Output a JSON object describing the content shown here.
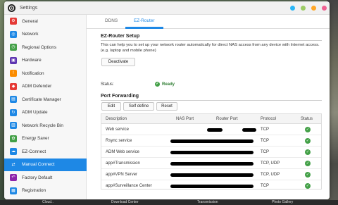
{
  "window": {
    "title": "Settings"
  },
  "sidebar": {
    "items": [
      {
        "label": "General",
        "icon": "gear-icon",
        "color": "#e53935",
        "glyph": "⚙"
      },
      {
        "label": "Network",
        "icon": "globe-icon",
        "color": "#1e88e5",
        "glyph": "◎"
      },
      {
        "label": "Regional Options",
        "icon": "clock-icon",
        "color": "#43a047",
        "glyph": "◷"
      },
      {
        "label": "Hardware",
        "icon": "chip-icon",
        "color": "#5e35b1",
        "glyph": "▣"
      },
      {
        "label": "Notification",
        "icon": "bell-icon",
        "color": "#fb8c00",
        "glyph": "!"
      },
      {
        "label": "ADM Defender",
        "icon": "shield-icon",
        "color": "#e53935",
        "glyph": "◆"
      },
      {
        "label": "Certificate Manager",
        "icon": "certificate-icon",
        "color": "#1e88e5",
        "glyph": "▤"
      },
      {
        "label": "ADM Update",
        "icon": "update-icon",
        "color": "#1e88e5",
        "glyph": "↻"
      },
      {
        "label": "Network Recycle Bin",
        "icon": "recycle-bin-icon",
        "color": "#1e88e5",
        "glyph": "▥"
      },
      {
        "label": "Energy Saver",
        "icon": "leaf-icon",
        "color": "#43a047",
        "glyph": "✿"
      },
      {
        "label": "EZ-Connect",
        "icon": "cloud-icon",
        "color": "#1e88e5",
        "glyph": "☁"
      },
      {
        "label": "Manual Connect",
        "icon": "connect-icon",
        "color": "#ffffff",
        "glyph": "⇄",
        "active": true
      },
      {
        "label": "Factory Default",
        "icon": "undo-icon",
        "color": "#8e24aa",
        "glyph": "↶"
      },
      {
        "label": "Registration",
        "icon": "registration-icon",
        "color": "#1e88e5",
        "glyph": "▦"
      }
    ]
  },
  "tabs": [
    {
      "label": "DDNS"
    },
    {
      "label": "EZ-Router",
      "active": true
    }
  ],
  "ez_router": {
    "title": "EZ-Router Setup",
    "description": "This can help you to set up your network router automatically for direct NAS access from any device with Internet access. (e.g. laptop and mobile phone)",
    "deactivate_label": "Deactivate",
    "status_label": "Status:",
    "status_value": "Ready"
  },
  "port_forwarding": {
    "title": "Port Forwarding",
    "buttons": {
      "edit": "Edit",
      "self_define": "Self define",
      "reset": "Reset"
    },
    "columns": [
      "Description",
      "NAS Port",
      "Router Port",
      "Protocol",
      "Status"
    ],
    "rows": [
      {
        "description": "Web service",
        "protocol": "TCP"
      },
      {
        "description": "Rsync service",
        "protocol": "TCP"
      },
      {
        "description": "ADM Web service",
        "protocol": "TCP"
      },
      {
        "description": "app#Transmission",
        "protocol": "TCP, UDP"
      },
      {
        "description": "app#VPN Server",
        "protocol": "TCP, UDP"
      },
      {
        "description": "app#Surveillance Center",
        "protocol": "TCP"
      }
    ]
  },
  "colors": {
    "accent": "#1e88e5",
    "ok": "#43a047",
    "dot1": "#29b6f6",
    "dot2": "#9ccc65",
    "dot3": "#ffa726",
    "dot4": "#f06292"
  },
  "taskbar": {
    "items": [
      "Cloud..",
      "Download Center",
      "Transmission",
      "Photo Gallery"
    ]
  }
}
